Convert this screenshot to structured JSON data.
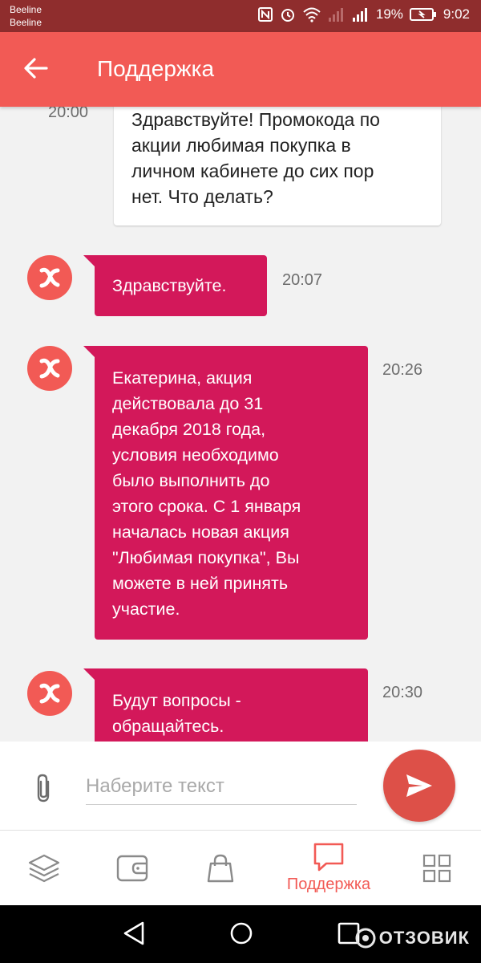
{
  "status_bar": {
    "carrier_1": "Beeline",
    "carrier_2": "Beeline",
    "battery_percent": "19%",
    "time": "9:02",
    "icons": [
      "nfc-icon",
      "alarm-icon",
      "wifi-icon",
      "signal-icon",
      "battery-icon"
    ]
  },
  "header": {
    "title": "Поддержка",
    "back_icon": "arrow-left-icon"
  },
  "messages": [
    {
      "sender": "user",
      "time": "20:00",
      "lines": [
        "Здравствуйте! Промокода по",
        "акции любимая покупка в",
        "личном кабинете до сих пор",
        "нет. Что делать?"
      ]
    },
    {
      "sender": "support",
      "time": "20:07",
      "lines": [
        "Здравствуйте."
      ]
    },
    {
      "sender": "support",
      "time": "20:26",
      "lines": [
        "Екатерина, акция",
        "действовала до 31",
        "декабря 2018 года,",
        "условия необходимо",
        "было выполнить до",
        "этого срока. С 1 января",
        "началась новая акция",
        "\"Любимая покупка\", Вы",
        "можете в ней принять",
        "участие."
      ]
    },
    {
      "sender": "support",
      "time": "20:30",
      "lines": [
        "Будут вопросы -",
        "обращайтесь."
      ]
    }
  ],
  "composer": {
    "placeholder": "Наберите текст",
    "value": ""
  },
  "bottom_nav": {
    "items": [
      {
        "icon": "layers-icon",
        "label": ""
      },
      {
        "icon": "wallet-icon",
        "label": ""
      },
      {
        "icon": "shopping-bag-icon",
        "label": ""
      },
      {
        "icon": "chat-bubble-icon",
        "label": "Поддержка",
        "active": true
      },
      {
        "icon": "grid-icon",
        "label": ""
      }
    ]
  },
  "watermark": "ОТЗОВИК",
  "colors": {
    "accent": "#f25a55",
    "support_bubble": "#d3185a",
    "send_button": "#dd5048",
    "status_bar": "#8f2d2d"
  }
}
